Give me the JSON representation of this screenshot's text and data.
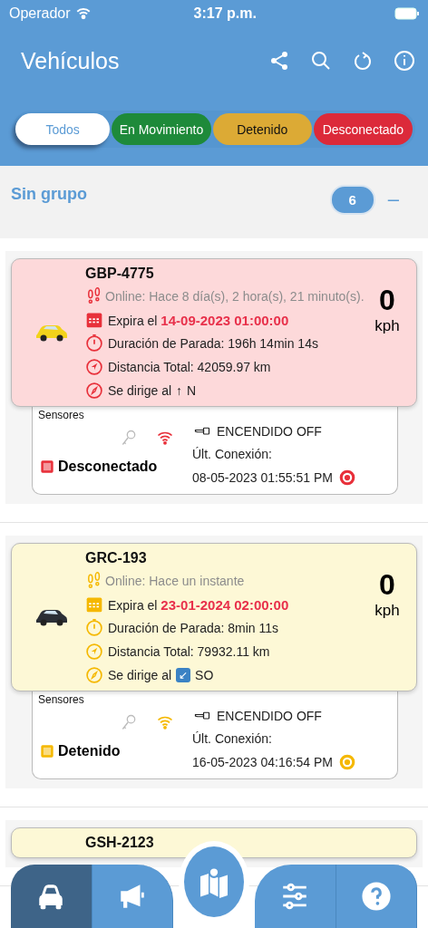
{
  "status_bar": {
    "carrier": "Operador",
    "time": "3:17 p.m."
  },
  "header": {
    "title": "Vehículos"
  },
  "filters": [
    {
      "label": "Todos",
      "kind": "all",
      "selected": true
    },
    {
      "label": "En Movimiento",
      "kind": "moving",
      "selected": false
    },
    {
      "label": "Detenido",
      "kind": "stopped",
      "selected": false
    },
    {
      "label": "Desconectado",
      "kind": "disconnected",
      "selected": false
    }
  ],
  "group": {
    "name": "Sin grupo",
    "count": "6",
    "collapse": "–"
  },
  "vehicles": [
    {
      "plate": "GBP-4775",
      "kind": "disconnected",
      "color": "#f2d21b",
      "online": "Online: Hace 8 día(s), 2 hora(s), 21 minuto(s).",
      "expires_label": "Expira el",
      "expires": "14-09-2023 01:00:00",
      "stop": "Duración de Parada: 196h 14min 14s",
      "distance": "Distancia Total: 42059.97 km",
      "heading_label": "Se dirige al",
      "heading_arrow": "↑",
      "heading_boxed": false,
      "heading": "N",
      "speed": "0",
      "unit": "kph",
      "sensors_label": "Sensores",
      "ignition": "ENCENDIDO OFF",
      "state": "Desconectado",
      "last_label": "Últ. Conexión:",
      "last": "08-05-2023 01:55:51 PM"
    },
    {
      "plate": "GRC-193",
      "kind": "stopped",
      "color": "#2b2f36",
      "online": "Online: Hace un instante",
      "expires_label": "Expira el",
      "expires": "23-01-2024 02:00:00",
      "stop": "Duración de Parada: 8min 11s",
      "distance": "Distancia Total: 79932.11 km",
      "heading_label": "Se dirige al",
      "heading_arrow": "↙",
      "heading_boxed": true,
      "heading": "SO",
      "speed": "0",
      "unit": "kph",
      "sensors_label": "Sensores",
      "ignition": "ENCENDIDO OFF",
      "state": "Detenido",
      "last_label": "Últ. Conexión:",
      "last": "16-05-2023 04:16:54 PM"
    },
    {
      "plate": "GSH-2123",
      "kind": "stopped"
    }
  ],
  "nav": [
    {
      "kind": "car",
      "selected": true
    },
    {
      "kind": "megaphone",
      "selected": false
    },
    {
      "kind": "map",
      "selected": false
    },
    {
      "kind": "sliders",
      "selected": false
    },
    {
      "kind": "help",
      "selected": false
    }
  ]
}
